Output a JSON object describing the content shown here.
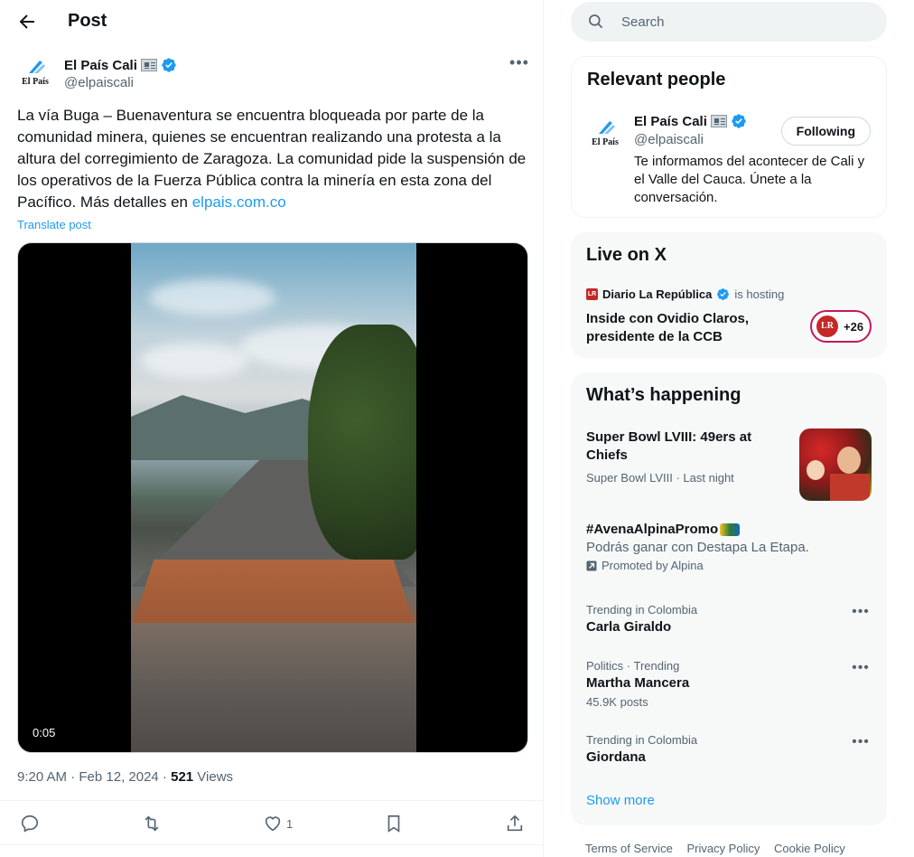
{
  "header": {
    "title": "Post"
  },
  "post": {
    "author_name": "El País Cali",
    "author_handle": "@elpaiscali",
    "avatar_text": "El País",
    "text": "La vía Buga – Buenaventura se encuentra bloqueada por parte de la comunidad minera, quienes se encuentran realizando una protesta a la altura del corregimiento de Zaragoza. La comunidad pide la suspensión de los operativos de la Fuerza Pública contra la minería en esta zona del Pacífico. Más detalles en ",
    "link": "elpais.com.co",
    "translate": "Translate post",
    "video_time": "0:05",
    "timestamp": "9:20 AM · Feb 12, 2024 · ",
    "views_count": "521",
    "views_label": " Views",
    "likes": "1"
  },
  "search": {
    "placeholder": "Search"
  },
  "relevant_people": {
    "title": "Relevant people",
    "name": "El País Cali",
    "handle": "@elpaiscali",
    "button": "Following",
    "bio": "Te informamos del acontecer de Cali y el Valle del Cauca. Únete a la conversación."
  },
  "live": {
    "title": "Live on X",
    "host": "Diario La República",
    "hosting": "is hosting",
    "topic": "Inside con Ovidio Claros, presidente de la CCB",
    "badge_logo": "LR",
    "listeners": "+26"
  },
  "happening": {
    "title": "What’s happening",
    "featured": {
      "title": "Super Bowl LVIII: 49ers at Chiefs",
      "meta": "Super Bowl LVIII · Last night"
    },
    "promo": {
      "title": "#AvenaAlpinaPromo",
      "subtitle": "Podrás ganar con Destapa La Etapa.",
      "promoted": "Promoted by Alpina"
    },
    "trends": [
      {
        "context": "Trending in Colombia",
        "name": "Carla Giraldo",
        "posts": ""
      },
      {
        "context": "Politics · Trending",
        "name": "Martha Mancera",
        "posts": "45.9K posts"
      },
      {
        "context": "Trending in Colombia",
        "name": "Giordana",
        "posts": ""
      }
    ],
    "show_more": "Show more"
  },
  "footer": {
    "links": [
      "Terms of Service",
      "Privacy Policy",
      "Cookie Policy"
    ]
  },
  "colors": {
    "accent": "#1d9bf0",
    "text": "#0f1419",
    "muted": "#536471",
    "live_pink": "#c2185b"
  }
}
